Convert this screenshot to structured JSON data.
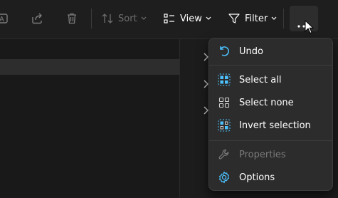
{
  "toolbar": {
    "sort_label": "Sort",
    "view_label": "View",
    "filter_label": "Filter",
    "icons": [
      "rename-icon",
      "share-icon",
      "delete-icon",
      "sort-icon",
      "view-icon",
      "filter-icon",
      "more-options-icon"
    ]
  },
  "menu": {
    "undo": "Undo",
    "select_all": "Select all",
    "select_none": "Select none",
    "invert_selection": "Invert selection",
    "properties": "Properties",
    "options": "Options"
  },
  "colors": {
    "accent": "#4cc2ff",
    "menu_bg": "#2c2c2c",
    "toolbar_bg": "#1e1e1e",
    "disabled_text": "#7a7a7a"
  }
}
